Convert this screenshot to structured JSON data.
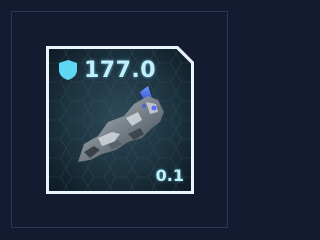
{
  "item_slot": {
    "stat": {
      "icon": "shield-icon",
      "value": "177.0"
    },
    "quantity": "0.1",
    "item_icon": "rock-ore-icon",
    "colors": {
      "frame": "#eaf6fb",
      "panel_dark": "#0f1e28",
      "panel_light": "#2e4a58",
      "accent": "#5fd7f5",
      "text": "#bff0fb",
      "background": "#141b30"
    }
  }
}
